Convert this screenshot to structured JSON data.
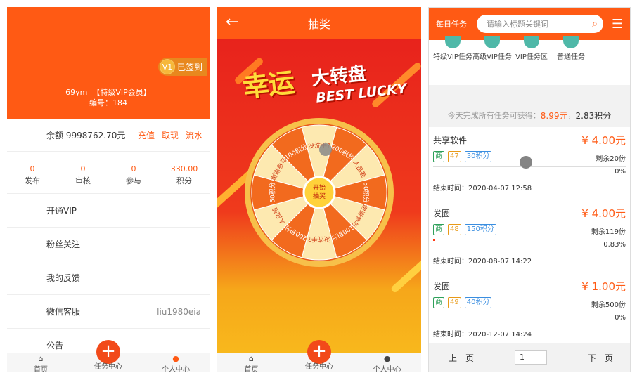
{
  "profile": {
    "checkin_level": "V1",
    "checkin_label": "已签到",
    "username": "69ym",
    "vip_tag": "【特级VIP会员】",
    "id_label": "编号：184",
    "balance_label": "余额 9998762.70元",
    "actions": [
      "充值",
      "取现",
      "流水"
    ],
    "stats": [
      {
        "value": "0",
        "label": "发布"
      },
      {
        "value": "0",
        "label": "审核"
      },
      {
        "value": "0",
        "label": "参与"
      },
      {
        "value": "330.00",
        "label": "积分"
      }
    ],
    "menu": [
      {
        "label": "开通VIP",
        "right": ""
      },
      {
        "label": "粉丝关注",
        "right": ""
      },
      {
        "label": "我的反馈",
        "right": ""
      },
      {
        "label": "微信客服",
        "right": "liu1980eia"
      },
      {
        "label": "公告",
        "right": ""
      }
    ]
  },
  "tabbar": {
    "home": "首页",
    "tasks": "任务中心",
    "me": "个人中心",
    "plus": "+"
  },
  "lottery": {
    "back_icon": "←",
    "title": "抽奖",
    "banner_cn1": "幸运",
    "banner_cn2": "大转盘",
    "banner_en": "BEST LUCKY",
    "center": [
      "开始",
      "抽奖"
    ],
    "segments": [
      "没洗手?",
      "200积分",
      "人品差",
      "50积分",
      "谢谢参与",
      "100积分",
      "没洗手?",
      "200积分",
      "人品差",
      "50积分",
      "谢谢参与",
      "100积分"
    ]
  },
  "tasks": {
    "header": "每日任务",
    "search_placeholder": "请输入标题关键词",
    "categories": [
      "特级VIP任务",
      "高级VIP任务",
      "VIP任务区",
      "普通任务"
    ],
    "earn_prefix": "今天完成所有任务可获得：",
    "earn_money": "8.99元",
    "earn_sep": "，",
    "earn_points": "2.83积分",
    "items": [
      {
        "name": "共享软件",
        "price": "¥ 4.00元",
        "tags": [
          "商",
          "47",
          "30积分"
        ],
        "remain": "剩余20份",
        "pct": "0%",
        "progress": 0,
        "end": "结束时间：2020-04-07 12:58"
      },
      {
        "name": "发圈",
        "price": "¥ 4.00元",
        "tags": [
          "商",
          "48",
          "150积分"
        ],
        "remain": "剩余119份",
        "pct": "0.83%",
        "progress": 0.0083,
        "end": "结束时间：2020-08-07 14:22"
      },
      {
        "name": "发圈",
        "price": "¥ 1.00元",
        "tags": [
          "商",
          "49",
          "40积分"
        ],
        "remain": "剩余500份",
        "pct": "0%",
        "progress": 0,
        "end": "结束时间：2020-12-07 14:24"
      }
    ],
    "prev": "上一页",
    "page": "1",
    "next": "下一页"
  }
}
